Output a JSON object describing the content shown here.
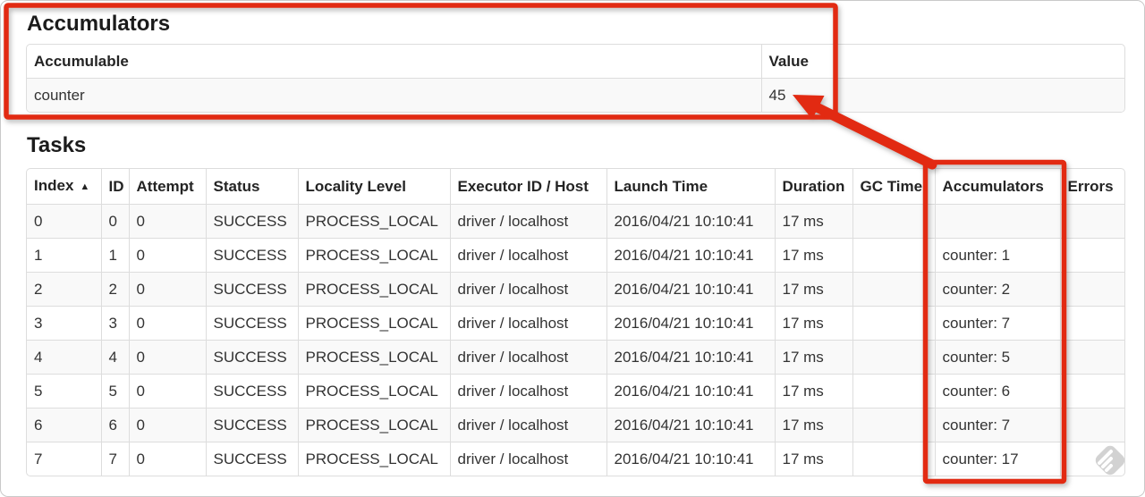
{
  "accumulators_section": {
    "title": "Accumulators",
    "table": {
      "sortable": false,
      "headers": [
        "Accumulable",
        "Value"
      ],
      "rows": [
        [
          "counter",
          "45"
        ]
      ]
    }
  },
  "tasks_section": {
    "title": "Tasks",
    "table": {
      "sortable": true,
      "sort": {
        "column": 0,
        "icon": "▲"
      },
      "headers": [
        "Index",
        "ID",
        "Attempt",
        "Status",
        "Locality Level",
        "Executor ID / Host",
        "Launch Time",
        "Duration",
        "GC Time",
        "Accumulators",
        "Errors"
      ],
      "rows": [
        [
          "0",
          "0",
          "0",
          "SUCCESS",
          "PROCESS_LOCAL",
          "driver / localhost",
          "2016/04/21 10:10:41",
          "17 ms",
          "",
          "",
          ""
        ],
        [
          "1",
          "1",
          "0",
          "SUCCESS",
          "PROCESS_LOCAL",
          "driver / localhost",
          "2016/04/21 10:10:41",
          "17 ms",
          "",
          "counter: 1",
          ""
        ],
        [
          "2",
          "2",
          "0",
          "SUCCESS",
          "PROCESS_LOCAL",
          "driver / localhost",
          "2016/04/21 10:10:41",
          "17 ms",
          "",
          "counter: 2",
          ""
        ],
        [
          "3",
          "3",
          "0",
          "SUCCESS",
          "PROCESS_LOCAL",
          "driver / localhost",
          "2016/04/21 10:10:41",
          "17 ms",
          "",
          "counter: 7",
          ""
        ],
        [
          "4",
          "4",
          "0",
          "SUCCESS",
          "PROCESS_LOCAL",
          "driver / localhost",
          "2016/04/21 10:10:41",
          "17 ms",
          "",
          "counter: 5",
          ""
        ],
        [
          "5",
          "5",
          "0",
          "SUCCESS",
          "PROCESS_LOCAL",
          "driver / localhost",
          "2016/04/21 10:10:41",
          "17 ms",
          "",
          "counter: 6",
          ""
        ],
        [
          "6",
          "6",
          "0",
          "SUCCESS",
          "PROCESS_LOCAL",
          "driver / localhost",
          "2016/04/21 10:10:41",
          "17 ms",
          "",
          "counter: 7",
          ""
        ],
        [
          "7",
          "7",
          "0",
          "SUCCESS",
          "PROCESS_LOCAL",
          "driver / localhost",
          "2016/04/21 10:10:41",
          "17 ms",
          "",
          "counter: 17",
          ""
        ]
      ]
    }
  },
  "annotations": {
    "color": "#e22a12"
  },
  "watermark": {
    "color": "#d2d2d2"
  }
}
